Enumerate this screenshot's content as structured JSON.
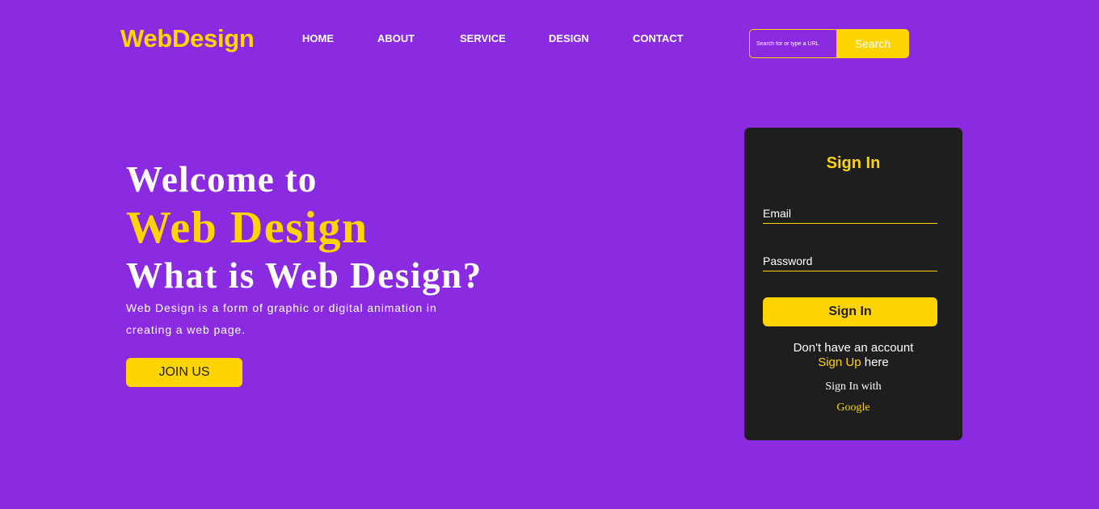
{
  "brand": {
    "logo": "WebDesign"
  },
  "nav": {
    "items": [
      {
        "label": "HOME"
      },
      {
        "label": "ABOUT"
      },
      {
        "label": "SERVICE"
      },
      {
        "label": "DESIGN"
      },
      {
        "label": "CONTACT"
      }
    ]
  },
  "search": {
    "placeholder": "Search for or type a URL",
    "value": "",
    "button_label": "Search"
  },
  "hero": {
    "line1": "Welcome to",
    "line2": "Web Design",
    "line3": "What is Web Design?",
    "description": "Web Design is a form of graphic or digital animation in creating a web page.",
    "cta_label": "JOIN US"
  },
  "signin": {
    "title": "Sign In",
    "email_placeholder": "Email",
    "password_placeholder": "Password",
    "button_label": "Sign In",
    "no_account_text": "Don't have an account",
    "signup_link": "Sign Up",
    "signup_suffix": " here",
    "signin_with": "Sign In with",
    "google_label": "Google"
  },
  "colors": {
    "background": "#8a2be2",
    "accent": "#ffd400",
    "card": "#1e1e1e",
    "text": "#ffffff"
  }
}
